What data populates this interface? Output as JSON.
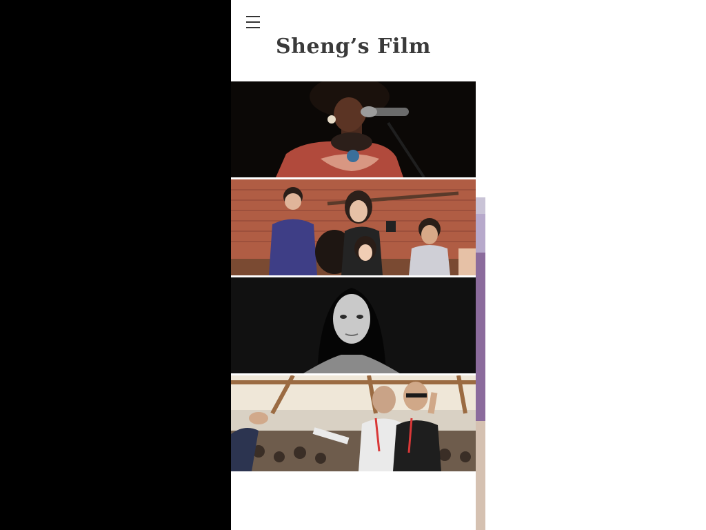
{
  "site": {
    "title": "Sheng’s Film"
  },
  "header": {
    "menu_icon": "hamburger-menu-icon"
  },
  "gallery": {
    "photos": [
      {
        "subject": "woman-singing-at-microphone"
      },
      {
        "subject": "group-filming-in-brick-room"
      },
      {
        "subject": "black-and-white-portrait-woman"
      },
      {
        "subject": "festival-crowd-celebrating"
      }
    ]
  },
  "colors": {
    "background": "#ffffff",
    "left_panel": "#000000",
    "title_text": "#3a3a3a"
  }
}
